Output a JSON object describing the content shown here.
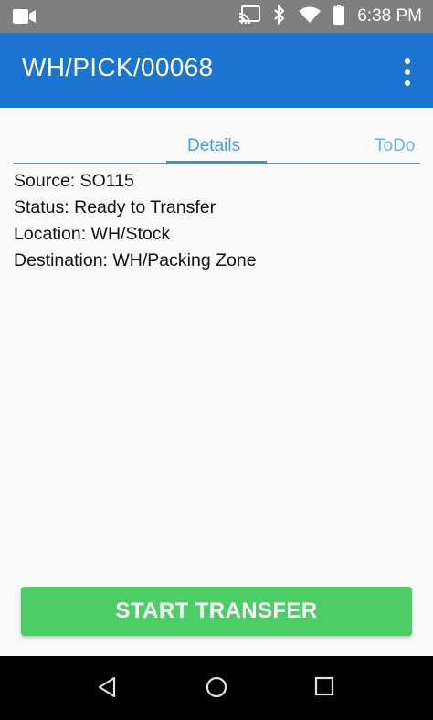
{
  "status_bar": {
    "time": "6:38 PM",
    "icons": [
      "video-camera-icon",
      "cast-icon",
      "bluetooth-icon",
      "wifi-icon",
      "battery-icon"
    ]
  },
  "app_bar": {
    "title": "WH/PICK/00068",
    "menu_icon": "more-vertical-icon",
    "background": "#1a74d0"
  },
  "tabs": [
    {
      "label": "Details",
      "selected": true
    },
    {
      "label": "ToDo",
      "selected": false
    }
  ],
  "details": {
    "source": "Source: SO115",
    "status": "Status: Ready to Transfer",
    "location": "Location: WH/Stock",
    "destination": "Destination: WH/Packing Zone"
  },
  "action": {
    "label": "START TRANSFER",
    "color": "#4ccd66"
  },
  "nav_bar": {
    "icons": [
      "back-icon",
      "home-icon",
      "recents-icon"
    ]
  }
}
